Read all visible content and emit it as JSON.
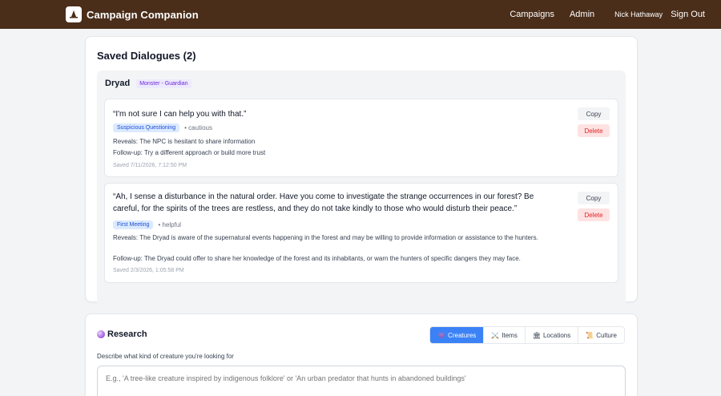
{
  "nav": {
    "brand": "Campaign Companion",
    "links": [
      "Campaigns",
      "Admin"
    ],
    "user": "Nick Hathaway",
    "signout": "Sign Out"
  },
  "saved": {
    "title": "Saved Dialogues (2)",
    "npc": {
      "name": "Dryad",
      "badge": "Monster - Guardian"
    },
    "dialogues": [
      {
        "quote": "“I'm not sure I can help you with that.”",
        "tag": "Suspicious Questioning",
        "mood": "• cautious",
        "reveals_label": "Reveals:",
        "reveals": "The NPC is hesitant to share information",
        "followup_label": "Follow-up:",
        "followup": "Try a different approach or build more trust",
        "saved": "Saved 7/11/2026, 7:12:50 PM",
        "copy": "Copy",
        "delete": "Delete"
      },
      {
        "quote": "“Ah, I sense a disturbance in the natural order. Have you come to investigate the strange occurrences in our forest? Be careful, for the spirits of the trees are restless, and they do not take kindly to those who would disturb their peace.”",
        "tag": "First Meeting",
        "mood": "• helpful",
        "reveals_label": "Reveals:",
        "reveals": "The Dryad is aware of the supernatural events happening in the forest and may be willing to provide information or assistance to the hunters.",
        "followup_label": "Follow-up:",
        "followup": "The Dryad could offer to share her knowledge of the forest and its inhabitants, or warn the hunters of specific dangers they may face.",
        "saved": "Saved 2/3/2026, 1:05:58 PM",
        "copy": "Copy",
        "delete": "Delete"
      }
    ]
  },
  "research": {
    "title": "Research",
    "tabs": [
      {
        "icon": "👾",
        "label": "Creatures"
      },
      {
        "icon": "⚔️",
        "label": "Items"
      },
      {
        "icon": "🏛",
        "label": "Locations"
      },
      {
        "icon": "📜",
        "label": "Culture"
      }
    ],
    "field_label": "Describe what kind of creature you're looking for",
    "placeholder": "E.g., 'A tree-like creature inspired by indigenous folklore' or 'An urban predator that hunts in abandoned buildings'"
  },
  "colors": {
    "nav_bg": "#4a2e1a",
    "accent": "#3b82f6",
    "delete": "#dc2626"
  }
}
